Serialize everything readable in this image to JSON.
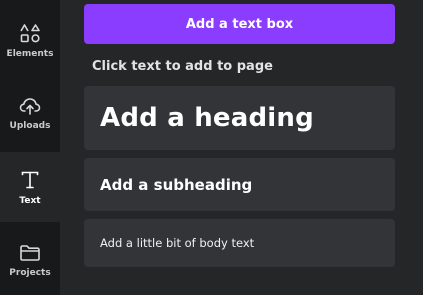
{
  "rail": {
    "items": [
      {
        "label": "Elements",
        "icon": "elements-icon"
      },
      {
        "label": "Uploads",
        "icon": "upload-cloud-icon"
      },
      {
        "label": "Text",
        "icon": "text-icon"
      },
      {
        "label": "Projects",
        "icon": "folder-icon"
      }
    ],
    "active": "Text"
  },
  "panel": {
    "add_text_box_label": "Add a text box",
    "section_title": "Click text to add to page",
    "cards": {
      "heading": "Add a heading",
      "subheading": "Add a subheading",
      "body": "Add a little bit of body text"
    }
  },
  "colors": {
    "accent": "#8b3dff",
    "background": "#18191b",
    "panel": "#252627",
    "card": "#333437"
  }
}
